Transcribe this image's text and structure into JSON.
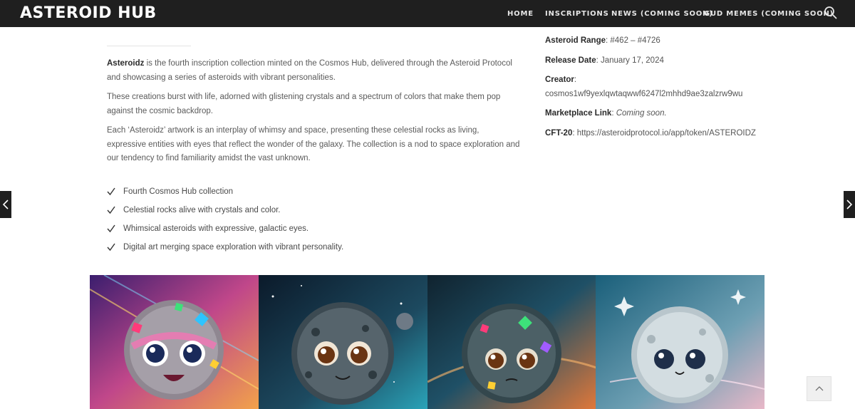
{
  "header": {
    "logo": "ASTEROID HUB",
    "nav": [
      {
        "label": "HOME"
      },
      {
        "label": "INSCRIPTIONS"
      },
      {
        "label": "NEWS (COMING SOON)"
      },
      {
        "label": "GUD MEMES (COMING SOON)"
      }
    ],
    "search_icon": "search-icon"
  },
  "content": {
    "paragraphs": [
      {
        "bold": "Asteroidz",
        "text": " is the fourth inscription collection minted on the Cosmos Hub, delivered through the Asteroid Protocol and showcasing a series of asteroids with vibrant personalities."
      },
      {
        "bold": "",
        "text": "These creations burst with life, adorned with glistening crystals and a spectrum of colors that make them pop against the cosmic backdrop."
      },
      {
        "bold": "",
        "text": "Each ‘Asteroidz’ artwork is an interplay of whimsy and space, presenting these celestial rocks as living, expressive entities with eyes that reflect the wonder of the galaxy. The collection is a nod to space exploration and our tendency to find familiarity amidst the vast unknown."
      }
    ],
    "checklist": [
      "Fourth Cosmos Hub collection",
      "Celestial rocks alive with crystals and color.",
      "Whimsical asteroids with expressive, galactic eyes.",
      "Digital art merging space exploration with vibrant personality."
    ]
  },
  "info": {
    "asteroid_range": {
      "label": "Asteroid Range",
      "value": "#462 – #4726"
    },
    "release_date": {
      "label": "Release Date",
      "value": "January 17, 2024"
    },
    "creator": {
      "label": "Creator",
      "value": "cosmos1wf9yexlqwtaqwwf6247l2mhhd9ae3zalzrw9wu"
    },
    "marketplace": {
      "label": "Marketplace Link",
      "value": "Coming soon."
    },
    "cft20": {
      "label": "CFT-20",
      "value": "https://asteroidprotocol.io/app/token/ASTEROIDZ"
    }
  },
  "gallery": {
    "images": [
      {
        "name": "asteroid-artwork-1"
      },
      {
        "name": "asteroid-artwork-2"
      },
      {
        "name": "asteroid-artwork-3"
      },
      {
        "name": "asteroid-artwork-4"
      }
    ]
  },
  "icons": {
    "prev": "chevron-left-icon",
    "next": "chevron-right-icon",
    "scroll_top": "chevron-up-icon",
    "check": "check-icon"
  },
  "colors": {
    "header_bg": "#1f1f1f",
    "text": "#555555"
  }
}
